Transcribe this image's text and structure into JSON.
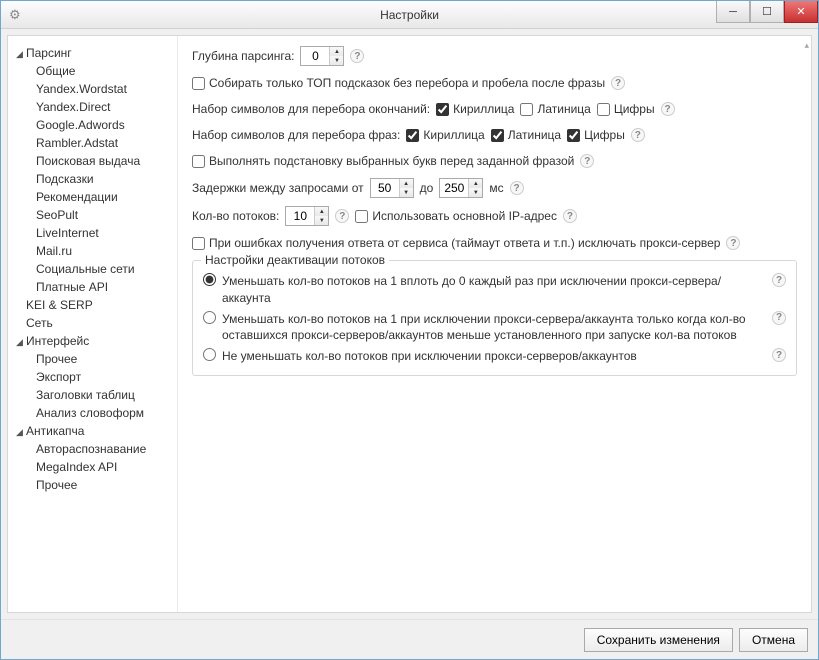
{
  "window": {
    "title": "Настройки"
  },
  "sidebar": {
    "groups": [
      {
        "label": "Парсинг",
        "expanded": true,
        "children": [
          "Общие",
          "Yandex.Wordstat",
          "Yandex.Direct",
          "Google.Adwords",
          "Rambler.Adstat",
          "Поисковая выдача",
          "Подсказки",
          "Рекомендации",
          "SeoPult",
          "LiveInternet",
          "Mail.ru",
          "Социальные сети",
          "Платные API"
        ]
      },
      {
        "label": "KEI & SERP",
        "expanded": false,
        "children": []
      },
      {
        "label": "Сеть",
        "expanded": false,
        "children": []
      },
      {
        "label": "Интерфейс",
        "expanded": true,
        "children": [
          "Прочее",
          "Экспорт",
          "Заголовки таблиц",
          "Анализ словоформ"
        ]
      },
      {
        "label": "Антикапча",
        "expanded": true,
        "children": [
          "Автораспознавание",
          "MegaIndex API",
          "Прочее"
        ]
      }
    ]
  },
  "settings": {
    "depth_label": "Глубина парсинга:",
    "depth_value": "0",
    "top_only_label": "Собирать только ТОП подсказок без перебора и пробела после фразы",
    "endings_label": "Набор символов для перебора окончаний:",
    "phrases_label": "Набор символов для перебора фраз:",
    "charset": {
      "cyr": "Кириллица",
      "lat": "Латиница",
      "dig": "Цифры"
    },
    "charset_endings": {
      "cyr": true,
      "lat": false,
      "dig": false
    },
    "charset_phrases": {
      "cyr": true,
      "lat": true,
      "dig": true
    },
    "prepend_label": "Выполнять подстановку выбранных букв перед заданной фразой",
    "delays": {
      "label_from": "Задержки между запросами от",
      "from": "50",
      "label_to": "до",
      "to": "250",
      "unit": "мс"
    },
    "threads": {
      "label": "Кол-во потоков:",
      "value": "10",
      "use_main_ip": "Использовать основной IP-адрес"
    },
    "proxy_exclude_label": "При ошибках получения ответа от сервиса (таймаут ответа и т.п.) исключать прокси-сервер",
    "deact": {
      "legend": "Настройки деактивации потоков",
      "opt1": "Уменьшать кол-во потоков на 1 вплоть до 0 каждый раз при исключении прокси-сервера/аккаунта",
      "opt2": "Уменьшать кол-во потоков на 1 при исключении прокси-сервера/аккаунта только когда кол-во оставшихся прокси-серверов/аккаунтов меньше установленного при запуске кол-ва потоков",
      "opt3": "Не уменьшать кол-во потоков при исключении прокси-серверов/аккаунтов"
    }
  },
  "footer": {
    "save": "Сохранить изменения",
    "cancel": "Отмена"
  }
}
